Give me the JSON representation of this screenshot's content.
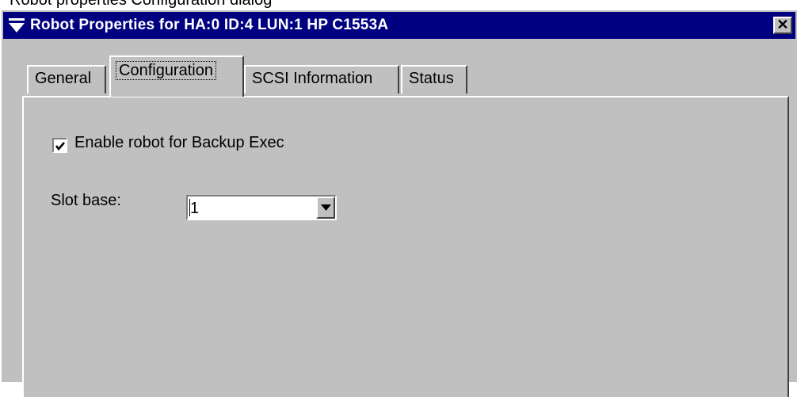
{
  "window": {
    "title": "Robot Properties for HA:0 ID:4 LUN:1 HP C1553A",
    "close_glyph": "✕",
    "icon": "window-menu-icon"
  },
  "top_strip": {
    "clipped_text": "Robot properties Configuration dialog"
  },
  "tabs": [
    {
      "label": "General",
      "selected": false
    },
    {
      "label": "Configuration",
      "selected": true
    },
    {
      "label": "SCSI Information",
      "selected": false
    },
    {
      "label": "Status",
      "selected": false
    }
  ],
  "configuration": {
    "enable_robot": {
      "label": "Enable robot for Backup Exec",
      "checked": true
    },
    "slot_base": {
      "label": "Slot base:",
      "value": "1"
    }
  },
  "colors": {
    "title_bar": "#000080",
    "face": "#c0c0c0",
    "highlight": "#ffffff",
    "shadow": "#404040"
  }
}
